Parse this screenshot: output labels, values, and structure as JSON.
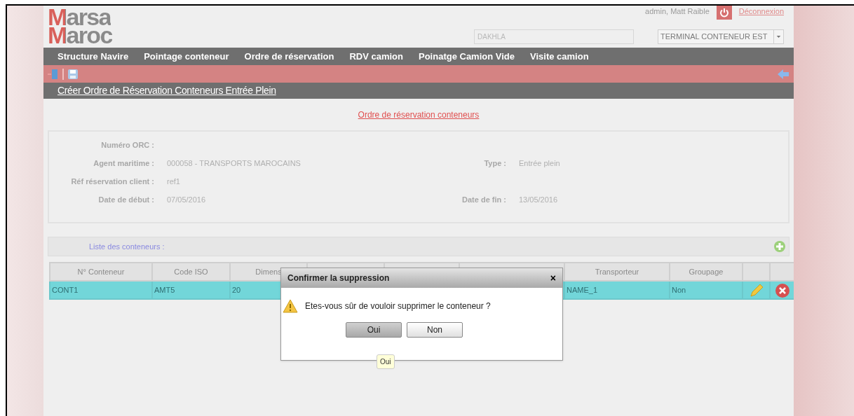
{
  "header": {
    "logo": [
      "Marsa",
      "Maroc"
    ],
    "user": "admin, Matt Raible",
    "logout": "Déconnexion",
    "site_field": {
      "placeholder": "DAKHLA"
    },
    "terminal_select": "TERMINAL CONTENEUR EST"
  },
  "nav": [
    "Structure Navire",
    "Pointage conteneur",
    "Ordre de réservation",
    "RDV camion",
    "Poinatge Camion Vide",
    "Visite camion"
  ],
  "page_title": "Créer Ordre de Réservation Conteneurs Entrée Plein",
  "section_link": "Ordre de réservation conteneurs",
  "info_rows": [
    [
      {
        "label": "Numéro ORC :"
      }
    ],
    [
      {
        "label": "Agent maritime :",
        "value": "000058 - TRANSPORTS MAROCAINS"
      },
      {
        "label": "Type :",
        "value": "Entrée plein"
      }
    ],
    [
      {
        "label": "Réf réservation client :",
        "value": "ref1"
      }
    ],
    [
      {
        "label": "Date de début :",
        "value": "07/05/2016"
      },
      {
        "label": "Date de fin :",
        "value": "13/05/2016"
      }
    ]
  ],
  "list_title": "Liste des conteneurs :",
  "table": {
    "columns": [
      "N° Conteneur",
      "Code ISO",
      "Dimens",
      "Transporteur",
      "Groupage"
    ],
    "rows": [
      {
        "selected": true,
        "cells": [
          "CONT1",
          "AMT5",
          "20",
          "NAME_1",
          "Non"
        ]
      }
    ]
  },
  "dialog": {
    "title": "Confirmer la suppression",
    "close": "×",
    "message": "Etes-vous sûr de vouloir supprimer le conteneur ?",
    "buttons": [
      {
        "label": "Oui",
        "focused": true
      },
      {
        "label": "Non",
        "focused": false
      }
    ],
    "tooltip": "Oui"
  }
}
